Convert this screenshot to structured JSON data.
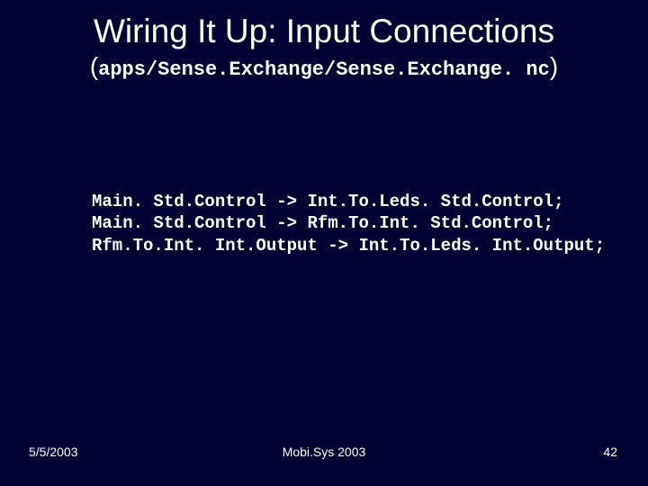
{
  "title": "Wiring It Up: Input Connections",
  "subtitle_path": "apps/Sense.Exchange/Sense.Exchange. nc",
  "paren_open": "(",
  "paren_close": ")",
  "code": {
    "line1": "Main. Std.Control -> Int.To.Leds. Std.Control;",
    "line2": "Main. Std.Control -> Rfm.To.Int. Std.Control;",
    "line3": "Rfm.To.Int. Int.Output -> Int.To.Leds. Int.Output;"
  },
  "footer": {
    "date": "5/5/2003",
    "venue": "Mobi.Sys 2003",
    "page": "42"
  }
}
